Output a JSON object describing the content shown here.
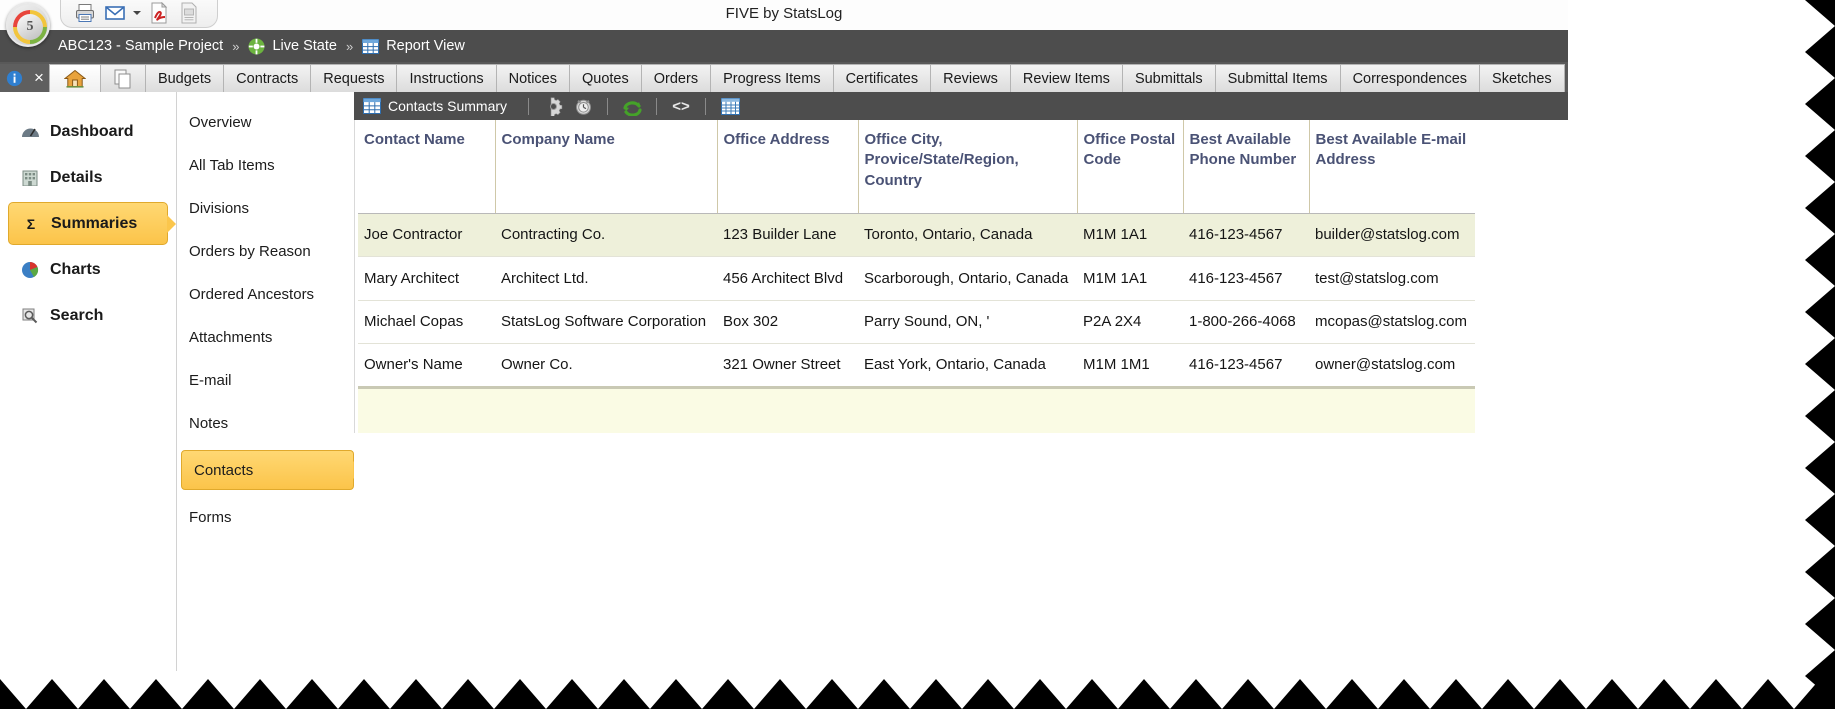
{
  "window": {
    "title": "FIVE by StatsLog",
    "logo_digit": "5"
  },
  "quick_access_toolbar": {
    "buttons": [
      {
        "name": "print-icon",
        "label": "Print"
      },
      {
        "name": "email-icon",
        "label": "E-mail"
      },
      {
        "name": "email-dropdown-caret-icon",
        "label": "E-mail options"
      },
      {
        "name": "pdf-icon",
        "label": "Export PDF"
      },
      {
        "name": "document-icon",
        "label": "Document"
      }
    ]
  },
  "breadcrumb": {
    "project": "ABC123 - Sample Project",
    "sep1": "»",
    "state": "Live State",
    "sep2": "»",
    "view": "Report View"
  },
  "tabstrip": {
    "system": [
      {
        "name": "info-icon",
        "label": "ⓘ"
      },
      {
        "name": "close-icon",
        "label": "×"
      }
    ],
    "home_icon": "home-icon",
    "copy_icon": "copy-icon",
    "tabs": [
      "Budgets",
      "Contracts",
      "Requests",
      "Instructions",
      "Notices",
      "Quotes",
      "Orders",
      "Progress Items",
      "Certificates",
      "Reviews",
      "Review Items",
      "Submittals",
      "Submittal Items",
      "Correspondences",
      "Sketches"
    ]
  },
  "sidebar": {
    "items": [
      {
        "label": "Dashboard",
        "icon": "gauge-icon",
        "active": false
      },
      {
        "label": "Details",
        "icon": "building-icon",
        "active": false
      },
      {
        "label": "Summaries",
        "icon": "sigma-icon",
        "active": true
      },
      {
        "label": "Charts",
        "icon": "pie-chart-icon",
        "active": false
      },
      {
        "label": "Search",
        "icon": "magnifier-icon",
        "active": false
      }
    ]
  },
  "subnav": {
    "items": [
      {
        "label": "Overview",
        "active": false
      },
      {
        "label": "All Tab Items",
        "active": false
      },
      {
        "label": "Divisions",
        "active": false
      },
      {
        "label": "Orders by Reason",
        "active": false
      },
      {
        "label": "Ordered Ancestors",
        "active": false
      },
      {
        "label": "Attachments",
        "active": false
      },
      {
        "label": "E-mail",
        "active": false
      },
      {
        "label": "Notes",
        "active": false
      },
      {
        "label": "Contacts",
        "active": true
      },
      {
        "label": "Forms",
        "active": false
      }
    ]
  },
  "report_toolbar": {
    "title": "Contacts Summary",
    "title_icon": "grid-table-icon",
    "buttons": [
      {
        "name": "gear-icon",
        "label": "Settings"
      },
      {
        "name": "clock-icon",
        "label": "Schedule"
      },
      {
        "name": "refresh-icon",
        "label": "Refresh"
      },
      {
        "name": "code-icon",
        "label": "<>"
      },
      {
        "name": "table-view-icon",
        "label": "Table View"
      }
    ]
  },
  "table": {
    "columns": [
      "Contact Name",
      "Company Name",
      "Office Address",
      "Office City, Provice/State/Region, Country",
      "Office Postal Code",
      "Best Available Phone Number",
      "Best Available E-mail Address"
    ],
    "rows": [
      {
        "highlighted": true,
        "cells": [
          "Joe Contractor",
          "Contracting Co.",
          "123 Builder Lane",
          "Toronto, Ontario, Canada",
          "M1M 1A1",
          "416-123-4567",
          "builder@statslog.com"
        ]
      },
      {
        "highlighted": false,
        "cells": [
          "Mary Architect",
          "Architect Ltd.",
          "456 Architect Blvd",
          "Scarborough, Ontario, Canada",
          "M1M 1A1",
          "416-123-4567",
          "test@statslog.com"
        ]
      },
      {
        "highlighted": false,
        "cells": [
          "Michael Copas",
          "StatsLog Software Corporation",
          "Box 302",
          "Parry Sound, ON, '",
          "P2A 2X4",
          "1-800-266-4068",
          "mcopas@statslog.com"
        ]
      },
      {
        "highlighted": false,
        "cells": [
          "Owner's Name",
          "Owner Co.",
          "321 Owner Street",
          "East York, Ontario, Canada",
          "M1M 1M1",
          "416-123-4567",
          "owner@statslog.com"
        ]
      }
    ]
  },
  "colors": {
    "dark_bar": "#4d4d4d",
    "tabstrip_bg": "#595959",
    "accent_yellow": "#fbc44a",
    "header_text": "#4a5275",
    "row_highlight": "#eef0da",
    "footer_band": "#fafbe4"
  }
}
